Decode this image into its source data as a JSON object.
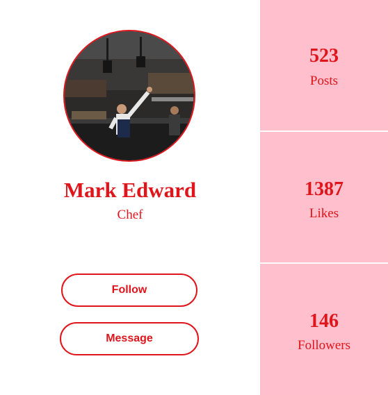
{
  "profile": {
    "name": "Mark Edward",
    "role": "Chef",
    "avatar_icon": "chef-in-kitchen-photo"
  },
  "actions": {
    "follow_label": "Follow",
    "message_label": "Message"
  },
  "stats": [
    {
      "value": "523",
      "label": "Posts"
    },
    {
      "value": "1387",
      "label": "Likes"
    },
    {
      "value": "146",
      "label": "Followers"
    }
  ],
  "colors": {
    "accent": "#e0151b",
    "stat_background": "#ffbfcc",
    "background": "#ffffff"
  }
}
